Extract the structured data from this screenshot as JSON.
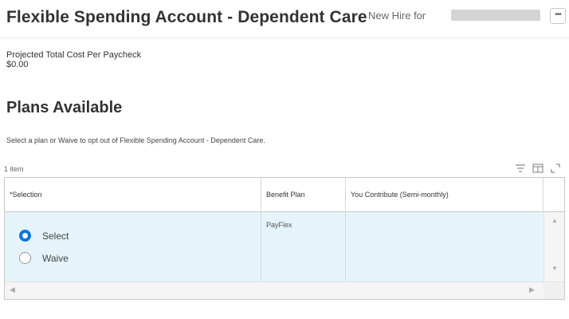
{
  "header": {
    "title": "Flexible Spending Account - Dependent Care",
    "subtitle": "New Hire for",
    "more_label": "•••"
  },
  "cost": {
    "label": "Projected Total Cost Per Paycheck",
    "value": "$0.00"
  },
  "plans": {
    "title": "Plans Available",
    "instructions": "Select a plan or Waive to opt out of Flexible Spending Account - Dependent Care.",
    "item_count": "1 item",
    "tool_icons": [
      "filter-icon",
      "columns-icon",
      "expand-icon"
    ],
    "columns": [
      "*Selection",
      "Benefit Plan",
      "You Contribute (Semi-monthly)"
    ],
    "rows": [
      {
        "options": [
          {
            "label": "Select",
            "selected": true
          },
          {
            "label": "Waive",
            "selected": false
          }
        ],
        "plan": "PayFlex",
        "contribution": ""
      }
    ]
  },
  "colors": {
    "accent": "#0875e1",
    "row_highlight": "#e5f4fa",
    "border": "#c8c8c8"
  }
}
